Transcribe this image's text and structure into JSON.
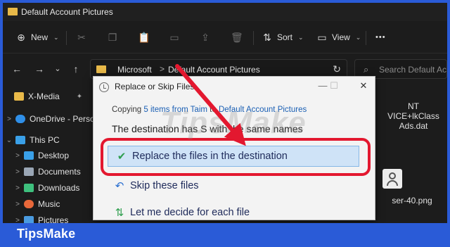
{
  "window": {
    "title": "Default Account Pictures"
  },
  "toolbar": {
    "new_label": "New",
    "sort_label": "Sort",
    "view_label": "View",
    "more_label": "•••"
  },
  "nav": {
    "back": "←",
    "forward": "→",
    "up_menu": "⌄",
    "up": "↑",
    "address": {
      "crumb1": "Microsoft",
      "separator": ">",
      "crumb2": "Default Account Pictures",
      "refresh": "↻"
    },
    "search_placeholder": "Search Default Account Pictures"
  },
  "sidebar": {
    "items": [
      {
        "label": "X-Media",
        "icon": "folder-icon",
        "pinned": "📌"
      },
      {
        "label": "OneDrive - Personal",
        "icon": "cloud-icon",
        "expander": ">"
      },
      {
        "label": "This PC",
        "icon": "computer-icon",
        "expander": "⌄"
      },
      {
        "label": "Desktop",
        "icon": "desktop-icon",
        "expander": ">"
      },
      {
        "label": "Documents",
        "icon": "documents-icon",
        "expander": ">"
      },
      {
        "label": "Downloads",
        "icon": "downloads-icon",
        "expander": ">"
      },
      {
        "label": "Music",
        "icon": "music-icon",
        "expander": ">"
      },
      {
        "label": "Pictures",
        "icon": "pictures-icon",
        "expander": ">"
      }
    ]
  },
  "content": {
    "file1": {
      "line1": "NT",
      "line2": "VICE+lkClass",
      "line3": "Ads.dat"
    },
    "file2": {
      "name": "ser-40.png"
    }
  },
  "dialog": {
    "title": "Replace or Skip Files",
    "minimize": "—",
    "maximize": "☐",
    "close": "✕",
    "copying_prefix": "Copying",
    "copying_count": "5 items from",
    "copying_source": "Taim",
    "copying_to": "to",
    "copying_dest": "Default Account Pictures",
    "destination_msg_a": "The destination has",
    "destination_msg_b": "S",
    "destination_msg_c": "with the same names",
    "options": [
      {
        "label": "Replace the files in the destination",
        "icon": "check-icon",
        "glyph": "✔",
        "selected": true
      },
      {
        "label": "Skip these files",
        "icon": "skip-icon",
        "glyph": "↶",
        "selected": false
      },
      {
        "label": "Let me decide for each file",
        "icon": "decide-icon",
        "glyph": "⇅",
        "selected": false
      }
    ]
  },
  "overlay": {
    "watermark": "TipsMake",
    "brand": "TipsMake",
    "accent_red": "#e3182f",
    "frame_blue": "#2a5bd7"
  }
}
